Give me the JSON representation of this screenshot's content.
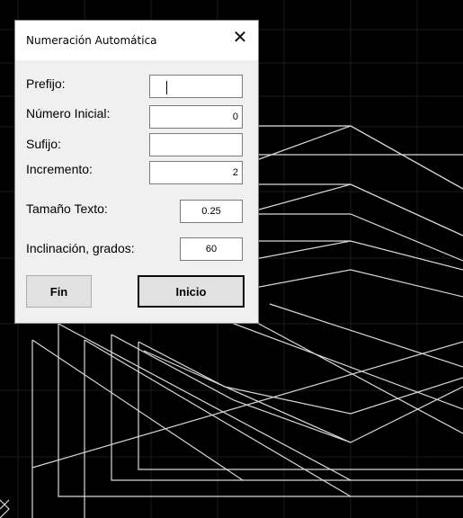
{
  "dialog": {
    "title": "Numeración Automática",
    "close_glyph": "✕",
    "fields": {
      "prefix": {
        "label": "Prefijo:",
        "value": ""
      },
      "start_number": {
        "label": "Número Inicial:",
        "value": "0"
      },
      "suffix": {
        "label": "Sufijo:",
        "value": ""
      },
      "increment": {
        "label": "Incremento:",
        "value": "2"
      },
      "text_size": {
        "label": "Tamaño Texto:",
        "value": "0.25"
      },
      "inclination": {
        "label": "Inclinación, grados:",
        "value": "60"
      }
    },
    "buttons": {
      "fin": "Fin",
      "inicio": "Inicio"
    }
  },
  "canvas": {
    "background": "#000000",
    "grid_color": "#1c1c1c",
    "line_color": "#d8d8d8"
  }
}
